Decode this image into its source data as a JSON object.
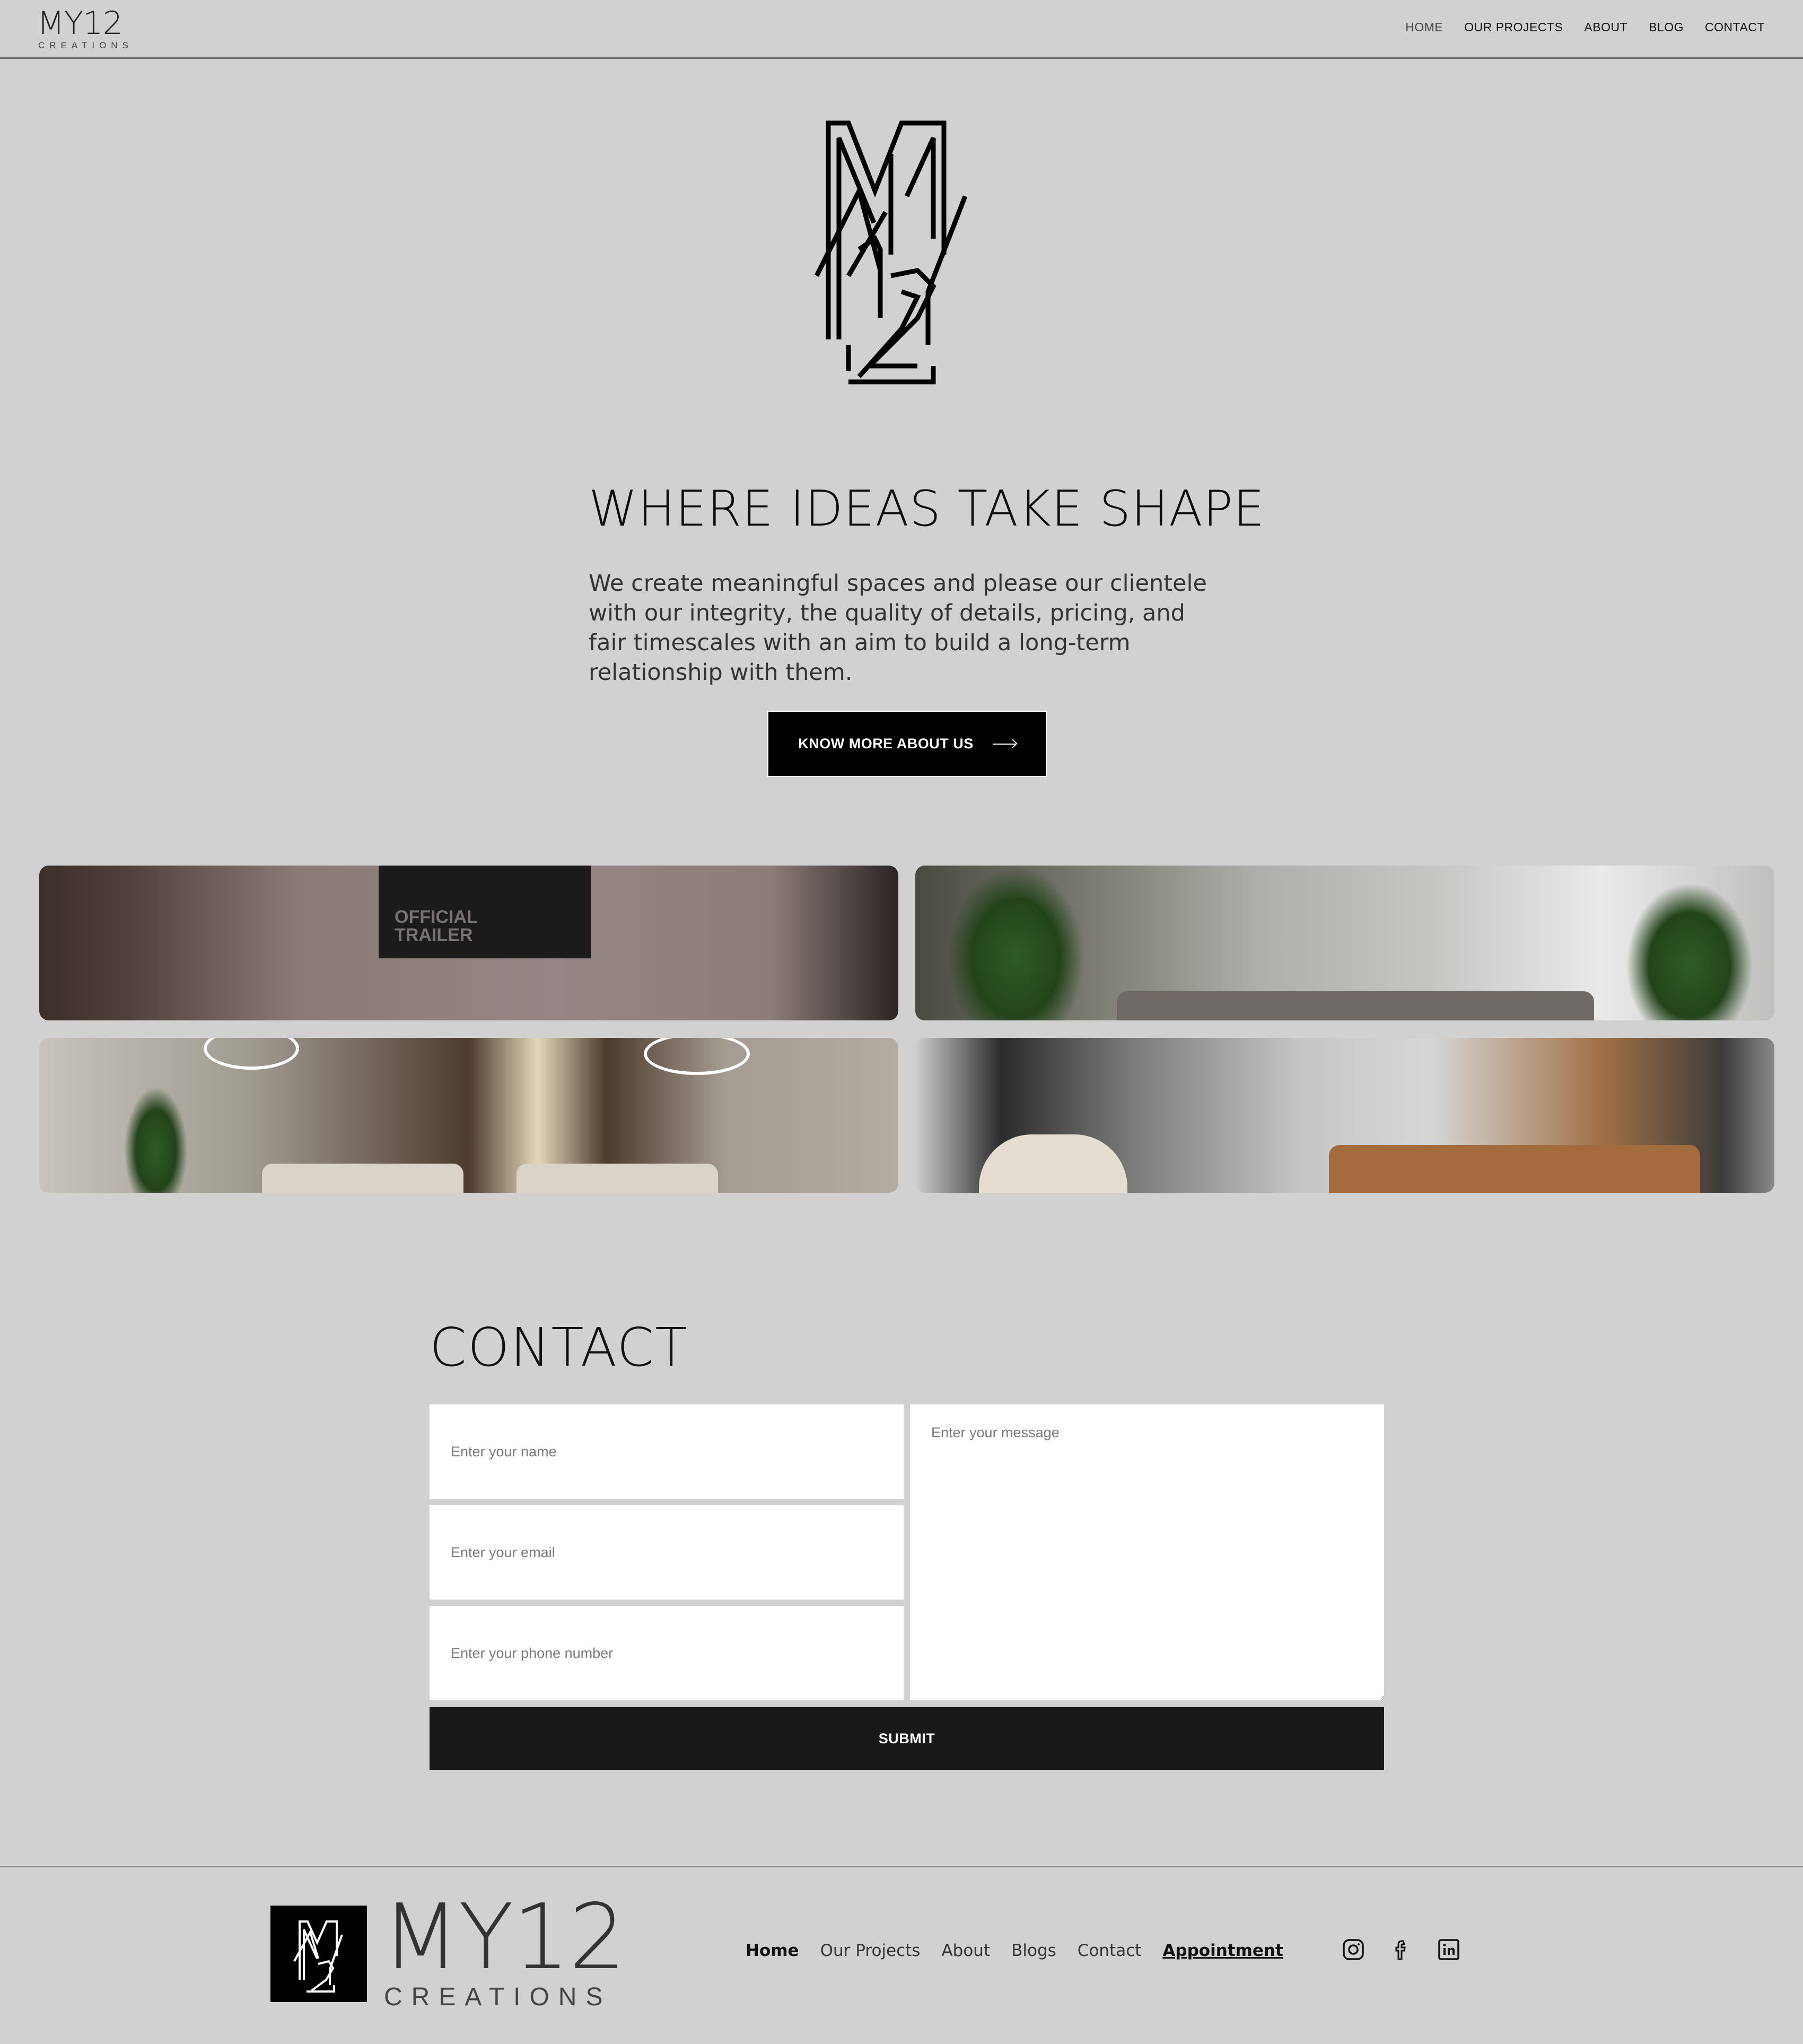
{
  "header": {
    "brand_main": "MY12",
    "brand_sub": "CREATIONS",
    "nav": [
      "HOME",
      "OUR PROJECTS",
      "ABOUT",
      "BLOG",
      "CONTACT"
    ]
  },
  "hero": {
    "title": "WHERE IDEAS TAKE SHAPE",
    "text_lines": [
      "We create meaningful spaces and please our clientele",
      "with our integrity, the quality of details, pricing, and",
      "fair timescales with an aim to build a long-term",
      "relationship with them."
    ],
    "cta_label": "KNOW MORE ABOUT US",
    "tv_text_1": "OFFICIAL",
    "tv_text_2": "TRAILER"
  },
  "contact": {
    "title": "CONTACT",
    "name_placeholder": "Enter your name",
    "email_placeholder": "Enter your email",
    "phone_placeholder": "Enter your phone number",
    "message_placeholder": "Enter your message",
    "submit_label": "SUBMIT"
  },
  "footer": {
    "brand_main": "MY12",
    "brand_sub": "CREATIONS",
    "nav": [
      "Home",
      "Our Projects",
      "About",
      "Blogs",
      "Contact",
      "Appointment"
    ],
    "socials": [
      "instagram-icon",
      "facebook-icon",
      "linkedin-icon"
    ]
  },
  "colors": {
    "background": "#d1d1d1",
    "button": "#000000",
    "submit": "#18181a"
  }
}
